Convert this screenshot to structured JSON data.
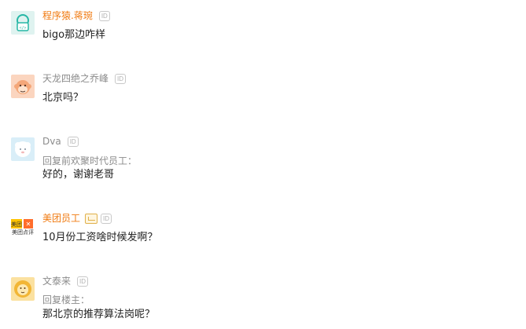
{
  "comments": [
    {
      "username": "程序猿.蒋琬",
      "name_color": "#f07a10",
      "id_badge": "ID",
      "avatar": "robot-avatar-icon",
      "reply_label": "",
      "text": "bigo那边咋样"
    },
    {
      "username": "天龙四绝之乔峰",
      "name_color": "#8c8c8c",
      "id_badge": "ID",
      "avatar": "monkey-avatar-icon",
      "reply_label": "",
      "text": "北京吗？"
    },
    {
      "username": "Dva",
      "name_color": "#8c8c8c",
      "id_badge": "ID",
      "avatar": "sheep-avatar-icon",
      "reply_label": "回复前欢聚时代员工：",
      "text": "好的，谢谢老哥"
    },
    {
      "username": "美团员工",
      "name_color": "#f07a10",
      "id_badge": "ID",
      "avatar": "meituan-logo-icon",
      "avatar_text": "美团点评",
      "reply_label": "",
      "text": "10月份工资啥时候发啊？"
    },
    {
      "username": "文泰来",
      "name_color": "#8c8c8c",
      "id_badge": "ID",
      "avatar": "lion-avatar-icon",
      "reply_label": "回复楼主：",
      "text": "那北京的推荐算法岗呢？"
    }
  ],
  "colors": {
    "orange_name": "#f07a10",
    "gray_name": "#8c8c8c",
    "text": "#222222",
    "avatar_teal": "#dff3f0",
    "avatar_peach": "#fbd5bf",
    "avatar_blue": "#d9eef8",
    "avatar_yellow": "#fbe1a0",
    "meituan_yellow": "#ffc300",
    "meituan_orange": "#ff6d2c"
  }
}
